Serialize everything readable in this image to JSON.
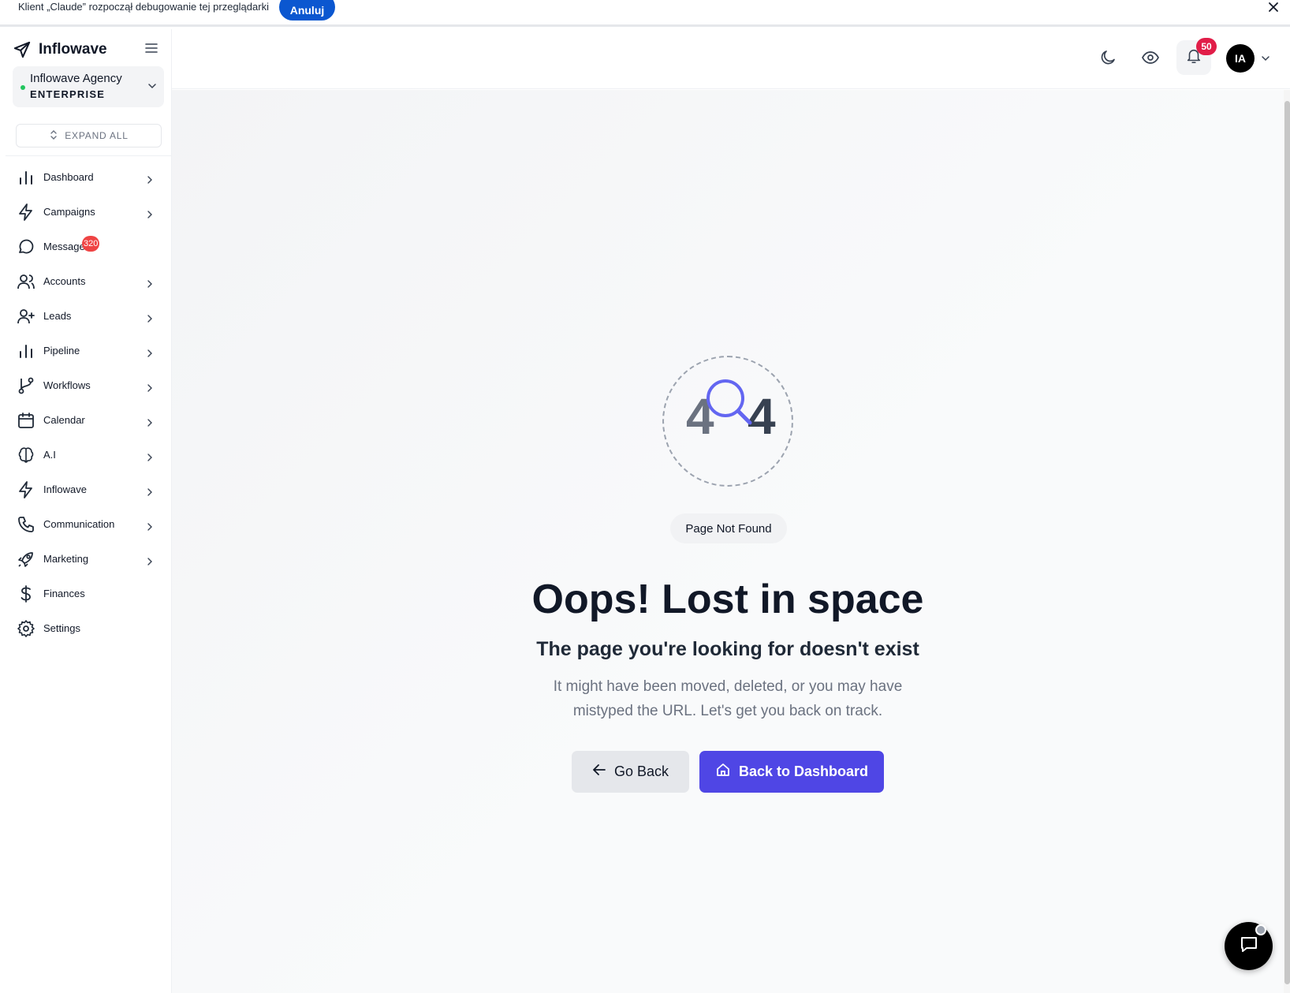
{
  "debug_banner": {
    "message": "Klient „Claude” rozpoczął debugowanie tej przeglądarki",
    "cancel_label": "Anuluj"
  },
  "brand": {
    "name": "Inflowave"
  },
  "org": {
    "name": "Inflowave Agency",
    "plan": "ENTERPRISE"
  },
  "sidebar": {
    "expand_label": "EXPAND ALL",
    "items": [
      {
        "label": "Dashboard",
        "icon": "bar-chart-icon"
      },
      {
        "label": "Campaigns",
        "icon": "lightning-icon"
      },
      {
        "label": "Messages",
        "icon": "chat-bubble-icon",
        "badge": "320"
      },
      {
        "label": "Accounts",
        "icon": "users-icon"
      },
      {
        "label": "Leads",
        "icon": "user-plus-icon"
      },
      {
        "label": "Pipeline",
        "icon": "bar-chart-icon"
      },
      {
        "label": "Workflows",
        "icon": "git-branch-icon"
      },
      {
        "label": "Calendar",
        "icon": "calendar-icon"
      },
      {
        "label": "A.I",
        "icon": "brain-icon"
      },
      {
        "label": "Inflowave",
        "icon": "lightning-icon"
      },
      {
        "label": "Communication",
        "icon": "phone-icon"
      },
      {
        "label": "Marketing",
        "icon": "rocket-icon"
      },
      {
        "label": "Finances",
        "icon": "dollar-icon"
      },
      {
        "label": "Settings",
        "icon": "gear-icon"
      }
    ]
  },
  "header": {
    "notification_count": "50",
    "avatar_initials": "IA"
  },
  "not_found": {
    "digit_left": "4",
    "digit_right": "4",
    "pill": "Page Not Found",
    "title": "Oops! Lost in space",
    "subtitle": "The page you're looking for doesn't exist",
    "description": "It might have been moved, deleted, or you may have mistyped the URL. Let's get you back on track.",
    "go_back_label": "Go Back",
    "dashboard_label": "Back to Dashboard"
  },
  "colors": {
    "accent": "#4f46e5",
    "badge_red": "#ef4444",
    "debug_blue": "#0b57d0",
    "status_green": "#22c55e"
  }
}
